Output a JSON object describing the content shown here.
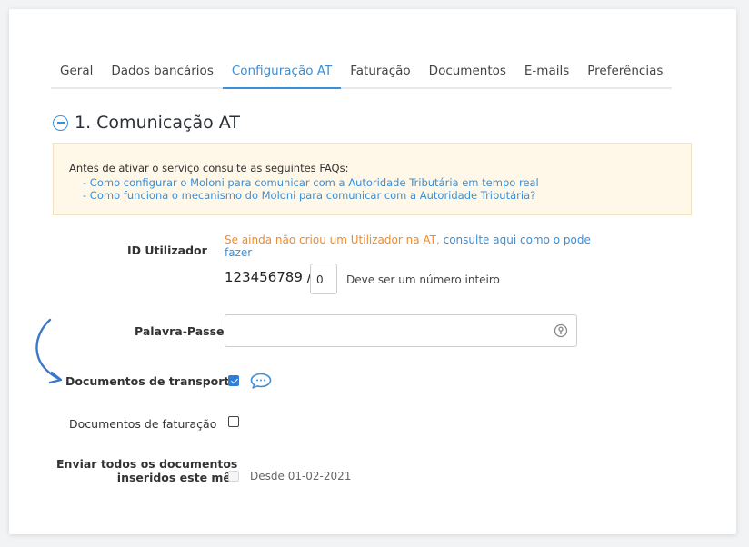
{
  "tabs": [
    "Geral",
    "Dados bancários",
    "Configuração AT",
    "Faturação",
    "Documentos",
    "E-mails",
    "Preferências"
  ],
  "active_tab_index": 2,
  "section": {
    "title": "1. Comunicação AT",
    "toggle_icon": "minus-circle-icon"
  },
  "info_box": {
    "intro": "Antes de ativar o serviço consulte as seguintes FAQs:",
    "faqs": [
      "- Como configurar o Moloni para comunicar com a Autoridade Tributária em tempo real",
      "- Como funciona o mecanismo do Moloni para comunicar com a Autoridade Tributária?"
    ]
  },
  "form": {
    "id_user": {
      "label": "ID Utilizador",
      "hint_orange": "Se ainda não criou um Utilizador na AT, ",
      "hint_link": "consulte aqui como o pode fazer",
      "nif": "123456789 /",
      "suffix_value": "0",
      "note": "Deve ser um número inteiro"
    },
    "password": {
      "label": "Palavra-Passe",
      "value": "",
      "icon": "key-icon"
    },
    "transport_docs": {
      "label": "Documentos de transporte",
      "checked": true,
      "icon": "chat-bubble-icon"
    },
    "invoice_docs": {
      "label": "Documentos de faturação",
      "checked": false
    },
    "send_all": {
      "label_line1": "Enviar todos os documentos",
      "label_line2": "inseridos este mês",
      "checked": false,
      "disabled": true,
      "since": "Desde 01-02-2021"
    }
  },
  "colors": {
    "accent": "#3b8fd6",
    "hint": "#f08a2b",
    "info_bg": "#fff7e8",
    "arrow": "#3b78c9"
  }
}
